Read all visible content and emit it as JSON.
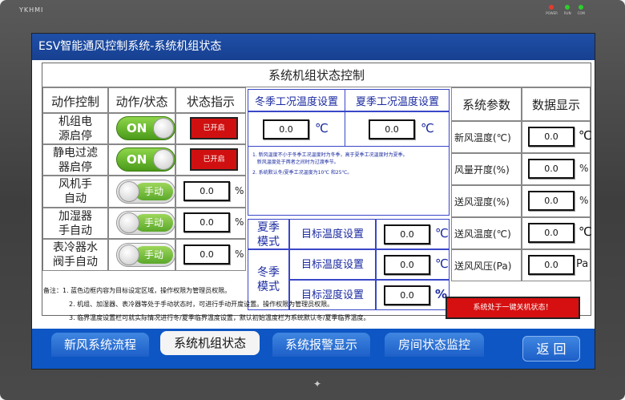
{
  "device": {
    "brand": "YKHMI",
    "leds": [
      {
        "label": "POWER",
        "color": "#e33b2e"
      },
      {
        "label": "RUN",
        "color": "#2ecc2e"
      },
      {
        "label": "COM",
        "color": "#2ecc2e"
      }
    ]
  },
  "window": {
    "title": "ESV智能通风控制系统-系统机组状态"
  },
  "panel": {
    "title": "系统机组状态控制"
  },
  "left_table": {
    "headers": [
      "动作控制",
      "动作/状态",
      "状态指示"
    ],
    "rows": [
      {
        "label": "机组电\n源启停",
        "toggle": "ON",
        "indicator": "已开启"
      },
      {
        "label": "静电过滤\n器启停",
        "toggle": "ON",
        "indicator": "已开启"
      },
      {
        "label": "风机手\n自动",
        "toggle": "手动",
        "value": "0.0",
        "unit": "%"
      },
      {
        "label": "加湿器\n手自动",
        "toggle": "手动",
        "value": "0.0",
        "unit": "%"
      },
      {
        "label": "表冷器水\n阀手自动",
        "toggle": "手动",
        "value": "0.0",
        "unit": "%"
      }
    ]
  },
  "season": {
    "winter_header": "冬季工况温度设置",
    "summer_header": "夏季工况温度设置",
    "winter_value": "0.0",
    "summer_value": "0.0",
    "unit": "℃",
    "notes": [
      "1. 新风温度不小于冬季工况温度时为冬季，高于夏季工况温度时为夏季。",
      "   新风温度处于两者之间时为过渡季节。",
      "2. 系统默认冬/夏季工况温度为10℃ 和25℃。"
    ]
  },
  "targets": {
    "summer_mode": "夏季\n模式",
    "winter_mode": "冬季\n模式",
    "rows": [
      {
        "label": "目标温度设置",
        "value": "0.0",
        "unit": "℃"
      },
      {
        "label": "目标温度设置",
        "value": "0.0",
        "unit": "℃"
      },
      {
        "label": "目标湿度设置",
        "value": "0.0",
        "unit": "%"
      }
    ]
  },
  "params": {
    "headers": [
      "系统参数",
      "数据显示"
    ],
    "rows": [
      {
        "label": "新风温度(℃)",
        "value": "0.0",
        "unit": "℃"
      },
      {
        "label": "风量开度(%)",
        "value": "0.0",
        "unit": "%"
      },
      {
        "label": "送风湿度(%)",
        "value": "0.0",
        "unit": "%"
      },
      {
        "label": "送风温度(℃)",
        "value": "0.0",
        "unit": "℃"
      },
      {
        "label": "送风风压(Pa)",
        "value": "0.0",
        "unit": "Pa"
      }
    ]
  },
  "notes": [
    "备注：1. 蓝色边框内容为目标设定区域，操作权限为管理员权限。",
    "2. 机组、加湿器、表冷器等处于手动状态时，可进行手动开度设置。操作权限为管理员权限。",
    "3. 临界温度设置栏可就实际情况进行冬/夏季临界温度设置，默认初始温度栏为系统默认冬/夏季临界温度。"
  ],
  "system_status": "系统处于一键关机状态！",
  "tabs": [
    {
      "label": "新风系统流程",
      "active": false
    },
    {
      "label": "系统机组状态",
      "active": true
    },
    {
      "label": "系统报警显示",
      "active": false
    },
    {
      "label": "房间状态监控",
      "active": false
    }
  ],
  "back_button": "返 回"
}
